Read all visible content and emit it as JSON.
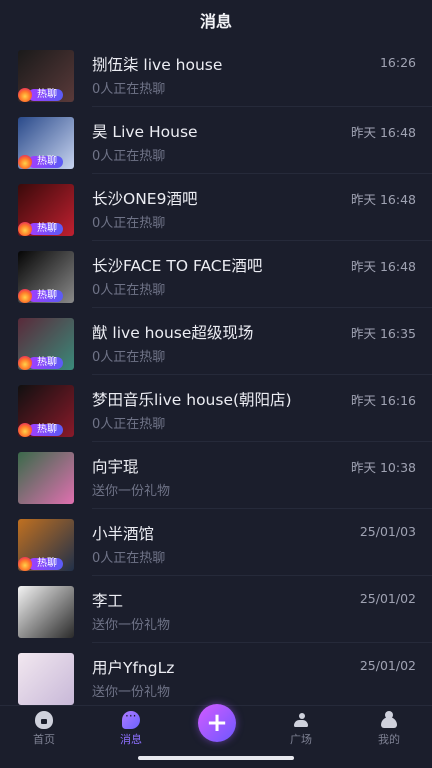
{
  "header": {
    "title": "消息"
  },
  "messages": [
    {
      "title": "捌伍柒 live house",
      "subtitle": "0人正在热聊",
      "time": "16:26",
      "hot": true,
      "badge": "热聊",
      "thumb_colors": [
        "#1a1a1a",
        "#5a3a3a"
      ]
    },
    {
      "title": "昊 Live House",
      "subtitle": "0人正在热聊",
      "time": "昨天 16:48",
      "hot": true,
      "badge": "热聊",
      "thumb_colors": [
        "#2a4a8a",
        "#c8d4f0"
      ]
    },
    {
      "title": "长沙ONE9酒吧",
      "subtitle": "0人正在热聊",
      "time": "昨天 16:48",
      "hot": true,
      "badge": "热聊",
      "thumb_colors": [
        "#3a0a0a",
        "#c02030"
      ]
    },
    {
      "title": "长沙FACE TO FACE酒吧",
      "subtitle": "0人正在热聊",
      "time": "昨天 16:48",
      "hot": true,
      "badge": "热聊",
      "thumb_colors": [
        "#050505",
        "#8a8a8a"
      ]
    },
    {
      "title": "猷 live house超级现场",
      "subtitle": "0人正在热聊",
      "time": "昨天 16:35",
      "hot": true,
      "badge": "热聊",
      "thumb_colors": [
        "#5a2a3a",
        "#3a8a7a"
      ]
    },
    {
      "title": "梦田音乐live house(朝阳店)",
      "subtitle": "0人正在热聊",
      "time": "昨天 16:16",
      "hot": true,
      "badge": "热聊",
      "thumb_colors": [
        "#101010",
        "#8a1a2a"
      ]
    },
    {
      "title": "向宇琨",
      "subtitle": "送你一份礼物",
      "time": "昨天 10:38",
      "hot": false,
      "badge": "",
      "thumb_colors": [
        "#3a6a4a",
        "#e070b0"
      ]
    },
    {
      "title": "小半酒馆",
      "subtitle": "0人正在热聊",
      "time": "25/01/03",
      "hot": true,
      "badge": "热聊",
      "thumb_colors": [
        "#c07020",
        "#20304a"
      ]
    },
    {
      "title": "李工",
      "subtitle": "送你一份礼物",
      "time": "25/01/02",
      "hot": false,
      "badge": "",
      "thumb_colors": [
        "#f4f4f4",
        "#2a2a2a"
      ]
    },
    {
      "title": "用户YfngLz",
      "subtitle": "送你一份礼物",
      "time": "25/01/02",
      "hot": false,
      "badge": "",
      "thumb_colors": [
        "#f2e8f0",
        "#c8b8d8"
      ]
    }
  ],
  "tabbar": {
    "tabs": [
      {
        "label": "首页",
        "icon": "home-icon",
        "active": false
      },
      {
        "label": "消息",
        "icon": "message-icon",
        "active": true
      },
      {
        "label": "广场",
        "icon": "square-icon",
        "active": false
      },
      {
        "label": "我的",
        "icon": "profile-icon",
        "active": false
      }
    ],
    "plus_label": "+"
  },
  "colors": {
    "background": "#1b1e2c",
    "accent": "#8e71ff",
    "badge_start": "#a33dff",
    "badge_end": "#5a5cf5"
  }
}
